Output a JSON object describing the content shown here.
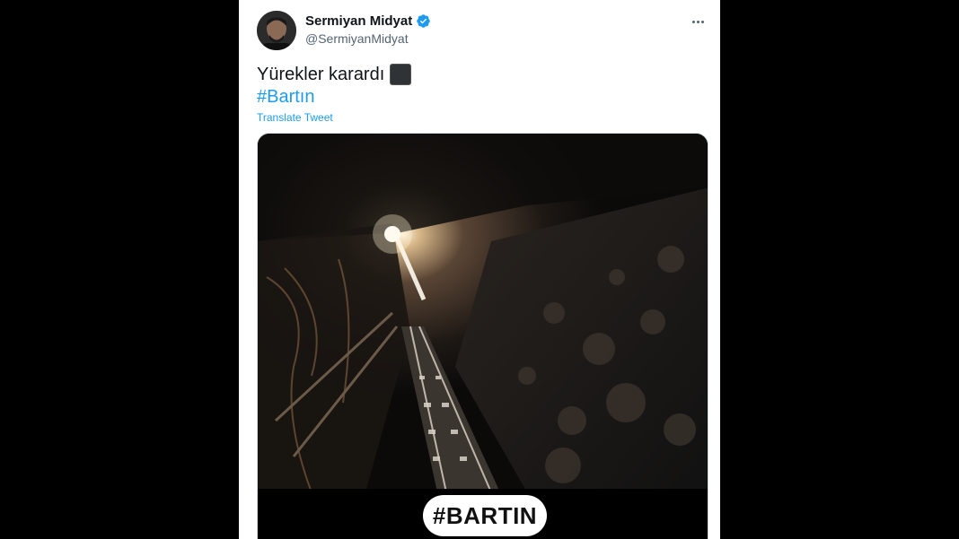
{
  "tweet": {
    "author_name": "Sermiyan Midyat",
    "author_handle": "@SermiyanMidyat",
    "text": "Yürekler karardı",
    "emoji": "black-large-square",
    "hashtag": "#Bartın",
    "translate_label": "Translate Tweet",
    "verified": true
  },
  "media": {
    "overlay_text": "#BARTIN",
    "description_icon": "mine-tunnel-photo"
  },
  "colors": {
    "link": "#1d9bf0",
    "verified_badge": "#1d9bf0",
    "text_primary": "#0f1419",
    "text_secondary": "#536471",
    "backdrop": "#000000"
  }
}
